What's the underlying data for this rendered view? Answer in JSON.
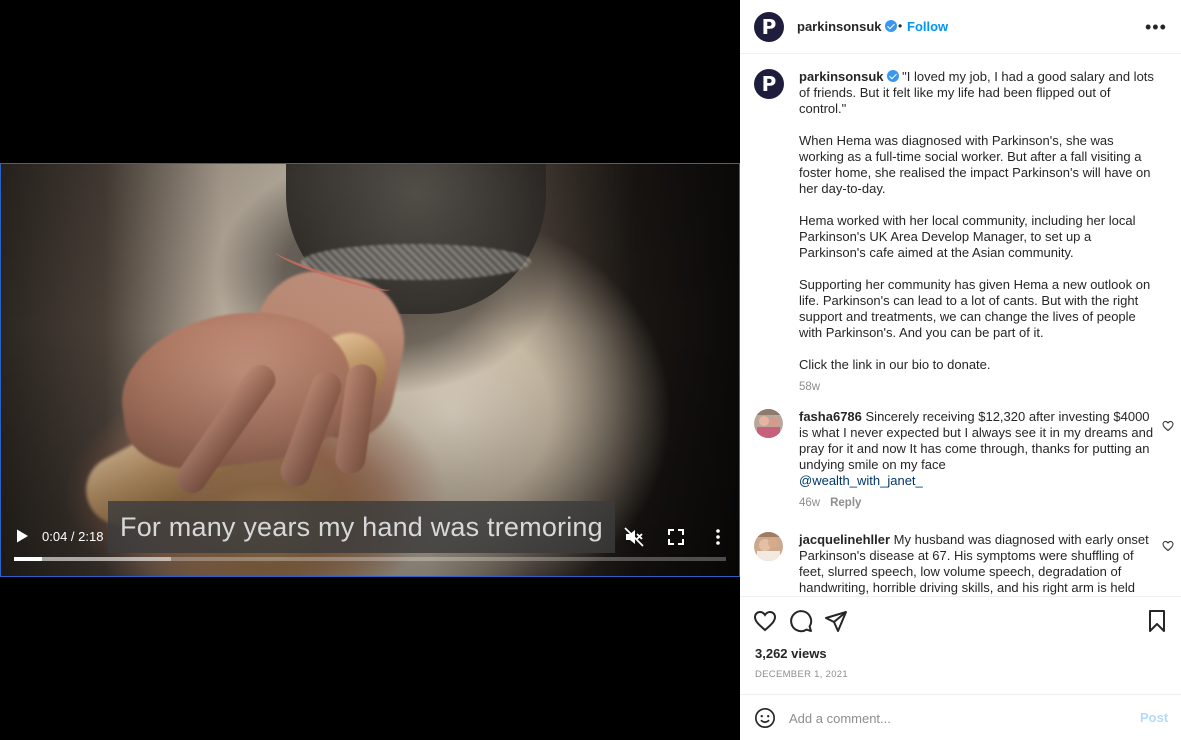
{
  "video": {
    "caption": "For many years my hand was tremoring",
    "time": "0:04 / 2:18",
    "progress_played": 0.04,
    "progress_buffered": 0.22
  },
  "header": {
    "username": "parkinsonsuk",
    "avatar_letter": "P",
    "separator": "•",
    "follow_label": "Follow",
    "more_label": "•••"
  },
  "post": {
    "username": "parkinsonsuk",
    "paragraphs": [
      "\"I loved my job, I had a good salary and lots of friends. But it felt like my life had been flipped out of control.\"",
      "When Hema was diagnosed with Parkinson's, she was working as a full-time social worker. But after a fall visiting a foster home, she realised the impact Parkinson's will have on her day-to-day.",
      "Hema worked with her local community, including her local Parkinson's UK Area Develop Manager, to set up a Parkinson's cafe aimed at the Asian community.",
      "Supporting her community has given Hema a new outlook on life. Parkinson's can lead to a lot of cants. But with the right support and treatments, we can change the lives of people with Parkinson's. And you can be part of it.",
      "Click the link in our bio to donate."
    ],
    "age": "58w"
  },
  "comments": [
    {
      "username": "fasha6786",
      "text": "Sincerely receiving $12,320 after investing $4000 is what I never expected but I always see it in my dreams and pray for it and now It has come through, thanks for putting an undying smile on my face",
      "mention": "@wealth_with_janet_",
      "age": "46w",
      "reply_label": "Reply"
    },
    {
      "username": "jacquelinehller",
      "text": "My husband was diagnosed with early onset Parkinson's disease at 67. His symptoms were shuffling of feet, slurred speech, low volume speech, degradation of handwriting, horrible driving skills, and his right arm is held"
    }
  ],
  "actions": {
    "views": "3,262 views",
    "date": "DECEMBER 1, 2021",
    "comment_placeholder": "Add a comment...",
    "post_label": "Post"
  },
  "colors": {
    "accent": "#0095f6",
    "verified": "#3897f0",
    "brand_avatar": "#1e1e3c"
  }
}
